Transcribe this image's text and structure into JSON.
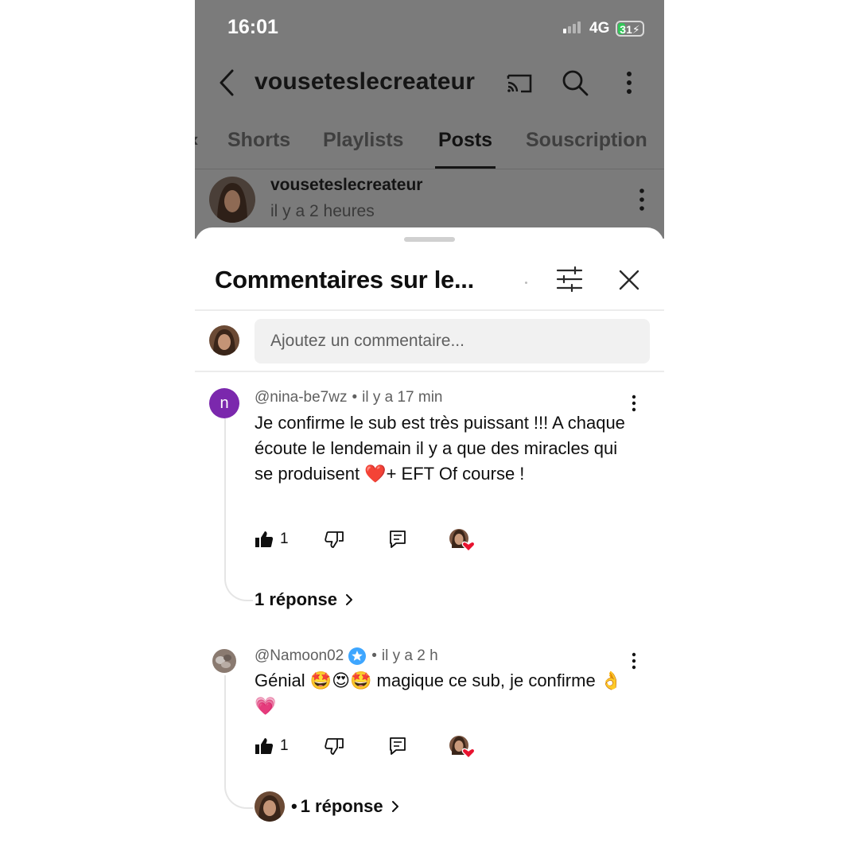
{
  "status_bar": {
    "time": "16:01",
    "network": "4G",
    "battery": "31",
    "battery_level": 0.31
  },
  "header": {
    "channel_name": "vouseteslecreateur",
    "icons": [
      "back-icon",
      "cast-icon",
      "search-icon",
      "more-vertical-icon"
    ]
  },
  "tabs": [
    {
      "label": "Shorts",
      "active": false
    },
    {
      "label": "Playlists",
      "active": false
    },
    {
      "label": "Posts",
      "active": true
    },
    {
      "label": "Souscription",
      "active": false
    }
  ],
  "post": {
    "author": "vouseteslecreateur",
    "time": "il y a 2 heures"
  },
  "sheet": {
    "title": "Commentaires sur le...",
    "comment_placeholder": "Ajoutez un commentaire..."
  },
  "comments": [
    {
      "avatar_letter": "n",
      "handle": "@nina-be7wz",
      "time": "il y a 17 min",
      "text": "Je confirme le sub est très puissant !!! A chaque écoute le lendemain il y a que des miracles qui se produisent ❤️+ EFT Of course !",
      "likes": "1",
      "replies": "1 réponse"
    },
    {
      "handle": "@Namoon02",
      "verified": true,
      "time": "il y a 2 h",
      "text": "Génial 🤩😍🤩 magique ce sub, je confirme 👌💗",
      "likes": "1",
      "replies": "1 réponse"
    }
  ],
  "colors": {
    "accent_purple": "#7b28ad",
    "heart_red": "#e8132f",
    "verified_blue": "#3ea6ff",
    "battery_green": "#32c759"
  }
}
